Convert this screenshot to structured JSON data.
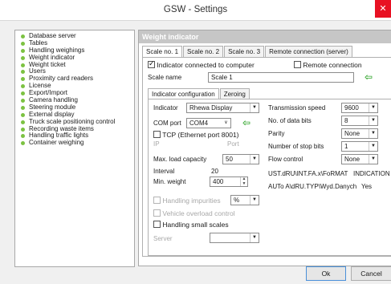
{
  "window": {
    "title": "GSW - Settings",
    "close_glyph": "✕"
  },
  "tree": {
    "items": [
      "Database server",
      "Tables",
      "Handling weighings",
      "Weight indicator",
      "Weight ticket",
      "Users",
      "Proximity card readers",
      "License",
      "Export/Import",
      "Camera handling",
      "Steering module",
      "External display",
      "Truck scale positioning control",
      "Recording waste items",
      "Handling traffic lights",
      "Container weighing"
    ],
    "bullet_color": "#7cc242"
  },
  "panel": {
    "header": "Weight indicator",
    "scale_tabs": [
      "Scale no. 1",
      "Scale no. 2",
      "Scale no. 3",
      "Remote connection (server)"
    ],
    "indicator_connected_label": "Indicator connected to computer",
    "remote_connection_label": "Remote connection",
    "scale_name_label": "Scale name",
    "scale_name_value": "Scale 1",
    "sub_tabs": [
      "Indicator configuration",
      "Zeroing"
    ],
    "left": {
      "indicator_label": "Indicator",
      "indicator_value": "Rhewa Display",
      "com_port_label": "COM port",
      "com_port_value": "COM4",
      "tcp_label": "TCP (Ethernet port 8001)",
      "ip_label": "IP",
      "port_label": "Port",
      "max_load_label": "Max. load capacity",
      "max_load_value": "50",
      "interval_label": "Interval",
      "interval_value": "20",
      "min_weight_label": "Min. weight",
      "min_weight_value": "400",
      "handling_impurities_label": "Handling impurities",
      "impurities_unit": "%",
      "vehicle_overload_label": "Vehicle overload control",
      "handling_small_scales_label": "Handling small scales",
      "server_label": "Server",
      "server_value": ""
    },
    "right": {
      "transmission_speed_label": "Transmission speed",
      "transmission_speed_value": "9600",
      "data_bits_label": "No. of data bits",
      "data_bits_value": "8",
      "parity_label": "Parity",
      "parity_value": "None",
      "stop_bits_label": "Number of stop bits",
      "stop_bits_value": "1",
      "flow_control_label": "Flow control",
      "flow_control_value": "None",
      "format_text": "UST.dRU\\INT.FA.x\\FoRMAT",
      "format_value": "INDICATION",
      "auto_text": "AUTo A\\dRU.TYP\\Wyd.Danych",
      "auto_value": "Yes"
    }
  },
  "buttons": {
    "ok": "Ok",
    "cancel": "Cancel"
  },
  "icons": {
    "arrow": "⇦",
    "dropdown": "▼",
    "chevron": "∨",
    "spin_up": "▲",
    "spin_down": "▼"
  },
  "colors": {
    "accent_green": "#3aa935",
    "close_red": "#e81123",
    "header_gray": "#c6c6c6"
  }
}
